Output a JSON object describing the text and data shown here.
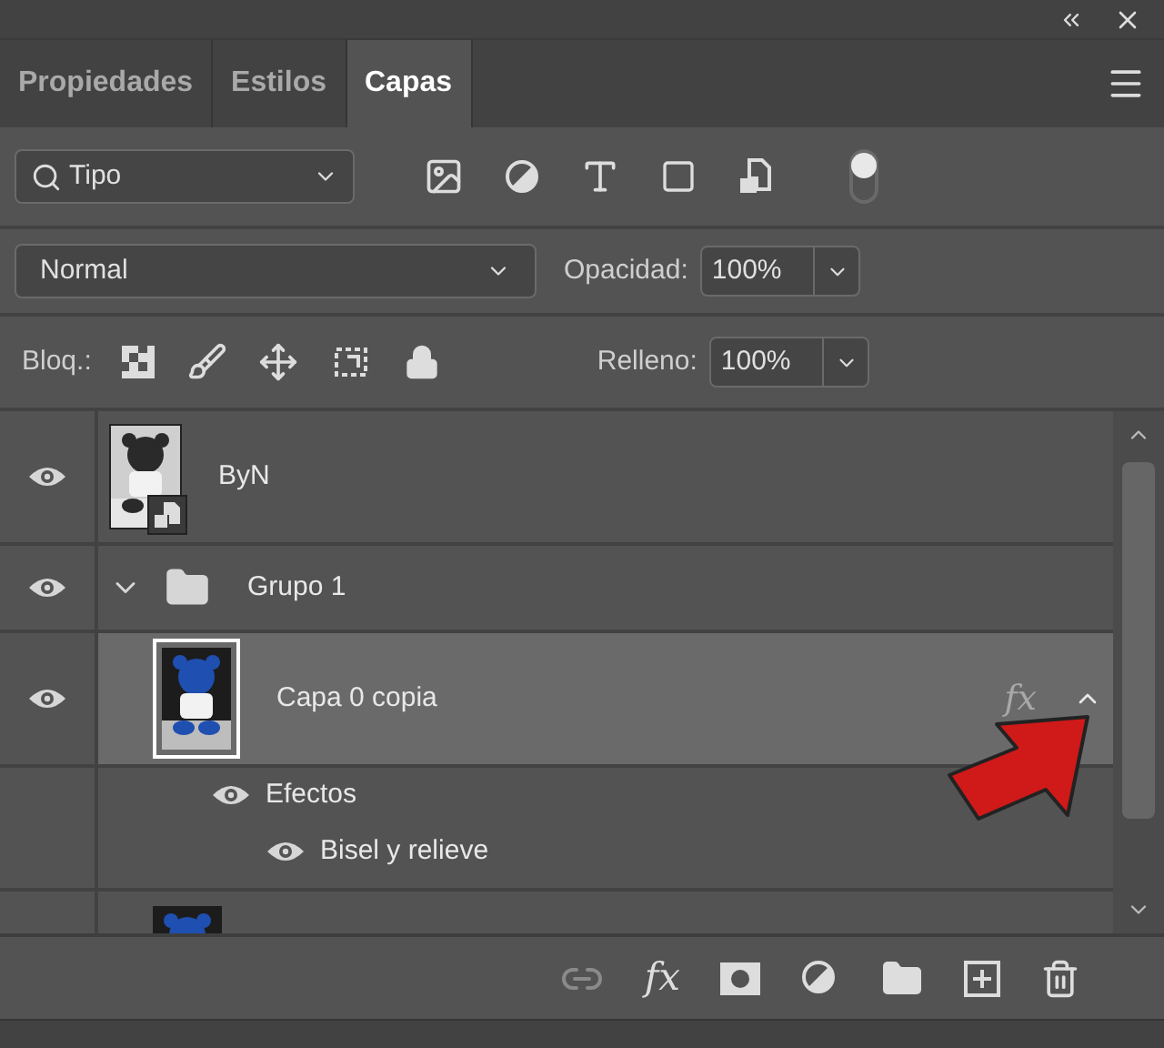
{
  "tabs": [
    {
      "label": "Propiedades",
      "selected": false
    },
    {
      "label": "Estilos",
      "selected": false
    },
    {
      "label": "Capas",
      "selected": true
    }
  ],
  "filter": {
    "value": "Tipo",
    "on": true
  },
  "blend_mode": "Normal",
  "opacity": {
    "label": "Opacidad:",
    "value": "100%"
  },
  "lock": {
    "label": "Bloq.:"
  },
  "fill": {
    "label": "Relleno:",
    "value": "100%"
  },
  "layers": [
    {
      "name": "ByN",
      "kind": "smart",
      "visible": true,
      "selected": false
    },
    {
      "name": "Grupo 1",
      "kind": "group",
      "visible": true,
      "expanded": true,
      "selected": false,
      "children": [
        {
          "name": "Capa 0 copia",
          "kind": "pixel",
          "visible": true,
          "selected": true,
          "fx": "fx",
          "effects": {
            "label": "Efectos",
            "visible": true,
            "expanded": true,
            "items": [
              {
                "name": "Bisel y relieve",
                "visible": true
              }
            ]
          }
        },
        {
          "kind": "pixel",
          "selected": false
        }
      ]
    }
  ],
  "footer": {
    "fx_label": "fx"
  }
}
